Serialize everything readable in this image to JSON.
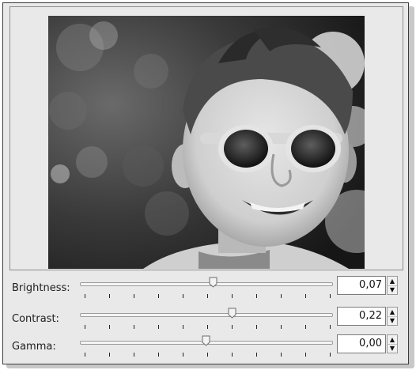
{
  "preview": {
    "image_alt": "Black and white photo of a smiling child wearing round sunglasses"
  },
  "controls": [
    {
      "label": "Brightness:",
      "value": "0,07",
      "slider_fraction": 0.53
    },
    {
      "label": "Contrast:",
      "value": "0,22",
      "slider_fraction": 0.6
    },
    {
      "label": "Gamma:",
      "value": "0,00",
      "slider_fraction": 0.5
    }
  ],
  "icons": {
    "spin_up": "spin-up-arrow-icon",
    "spin_down": "spin-down-arrow-icon"
  },
  "colors": {
    "window_bg": "#e9e9e9",
    "border": "#3c3c3c"
  }
}
